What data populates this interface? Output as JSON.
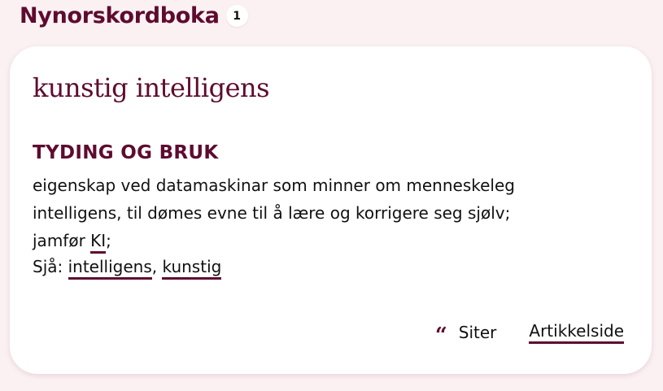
{
  "header": {
    "title": "Nynorskordboka",
    "result_count": "1"
  },
  "article": {
    "headword": "kunstig intelligens",
    "section_heading": "TYDING OG BRUK",
    "definition": "eigenskap ved datamaskinar som minner om menneskeleg intelligens, til dømes evne til å lære og korrigere seg sjølv;",
    "compare_prefix": "jamfør",
    "compare_link": "KI",
    "compare_suffix": ";",
    "see_prefix": "Sjå:",
    "see_links": [
      "intelligens",
      "kunstig"
    ],
    "see_separator": ","
  },
  "actions": {
    "cite_icon": "quote-icon",
    "cite_label": "Siter",
    "article_label": "Artikkelside"
  },
  "colors": {
    "accent": "#5e0b2f",
    "background": "#fbf1f2",
    "card": "#ffffff"
  }
}
